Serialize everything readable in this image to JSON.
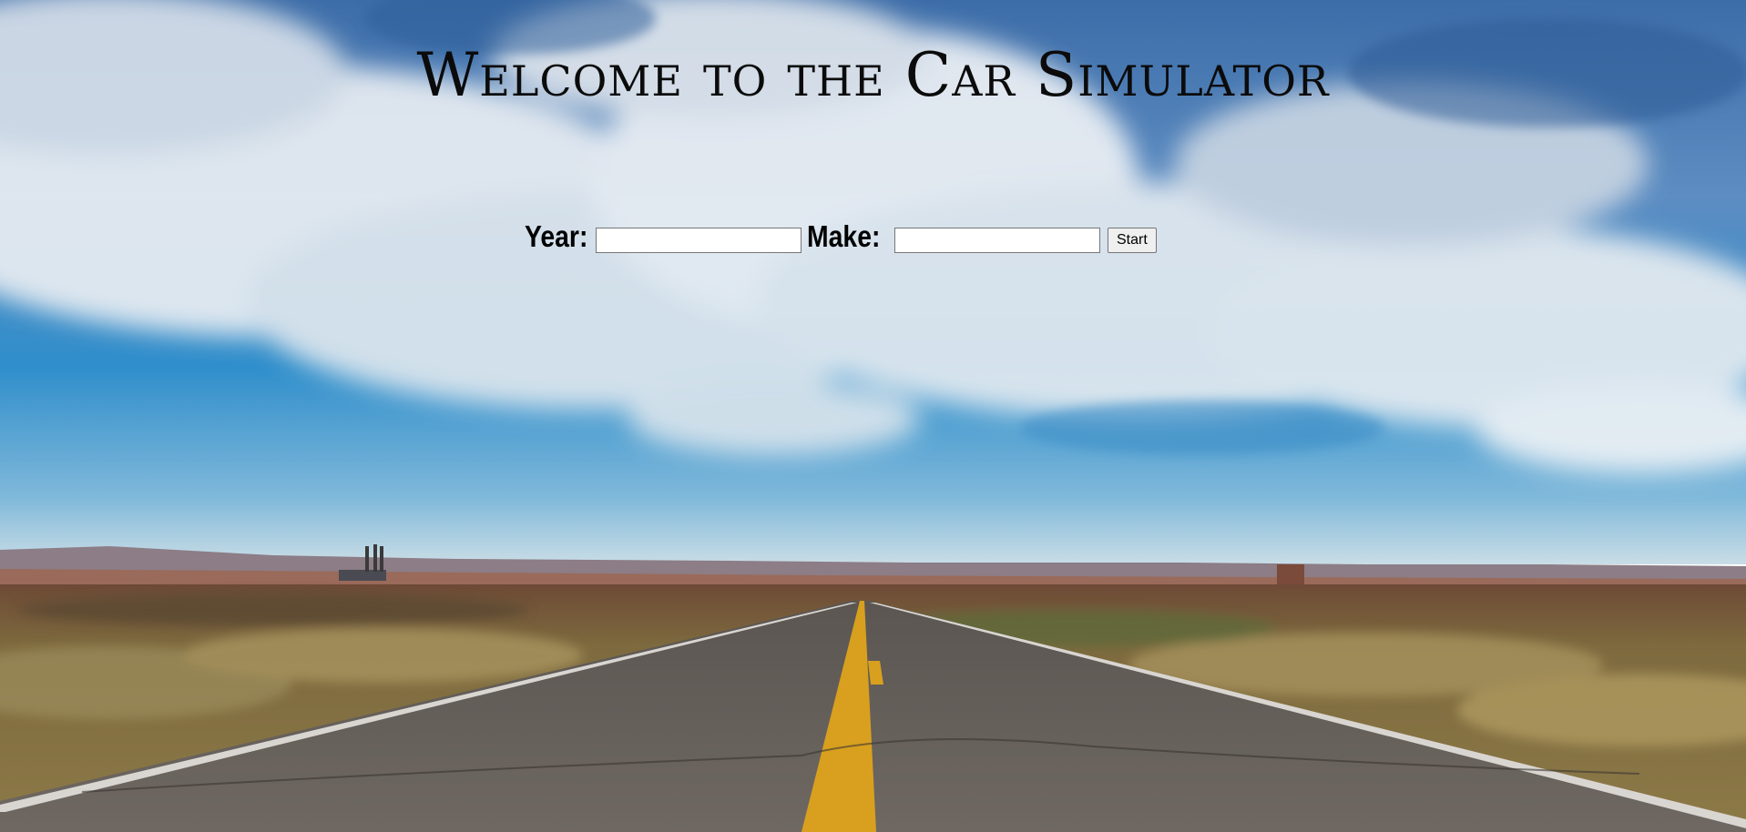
{
  "page": {
    "title": "Welcome to the Car Simulator"
  },
  "form": {
    "year_label": "Year:",
    "year_value": "",
    "make_label": "Make:",
    "make_value": "",
    "start_label": "Start"
  },
  "background": {
    "description_icon": "road-landscape-photo"
  },
  "colors": {
    "sky_top": "#3b6ea8",
    "sky_horizon": "#9ec6dc",
    "road": "#6e6660",
    "center_line": "#e0a020",
    "title_text": "#0b0b0b"
  }
}
